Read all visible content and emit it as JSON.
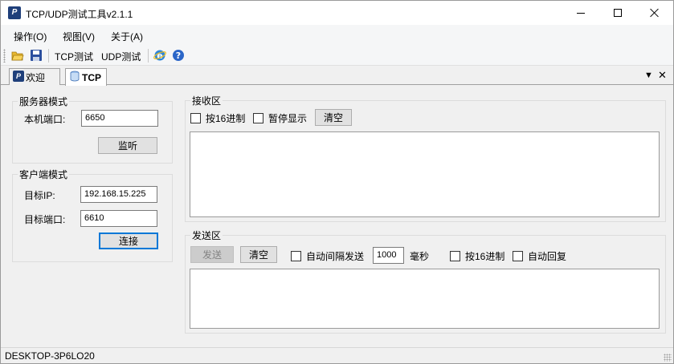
{
  "window": {
    "title": "TCP/UDP测试工具v2.1.1"
  },
  "menu": {
    "items": [
      {
        "label": "操作(O)"
      },
      {
        "label": "视图(V)"
      },
      {
        "label": "关于(A)"
      }
    ]
  },
  "toolbar": {
    "icons": [
      "open-folder-icon",
      "save-icon",
      "ie-browser-icon",
      "help-icon"
    ],
    "tcp_test_label": "TCP测试",
    "udp_test_label": "UDP测试"
  },
  "tabs": [
    {
      "label": "欢迎",
      "active": false
    },
    {
      "label": "TCP",
      "active": true
    }
  ],
  "tab_controls": {
    "dropdown": "▼",
    "close": "✕"
  },
  "server": {
    "group_title": "服务器模式",
    "port_label": "本机端口:",
    "port_value": "6650",
    "listen_button": "监听"
  },
  "client": {
    "group_title": "客户端模式",
    "ip_label": "目标IP:",
    "ip_value": "192.168.15.225",
    "port_label": "目标端口:",
    "port_value": "6610",
    "connect_button": "连接"
  },
  "receive": {
    "group_title": "接收区",
    "hex_checkbox": "按16进制",
    "hex_checked": false,
    "pause_checkbox": "暂停显示",
    "pause_checked": false,
    "clear_button": "清空"
  },
  "send": {
    "group_title": "发送区",
    "send_button": "发送",
    "clear_button": "清空",
    "auto_send_checkbox": "自动间隔发送",
    "auto_send_checked": false,
    "interval_value": "1000",
    "interval_unit": "毫秒",
    "hex_checkbox": "按16进制",
    "hex_checked": false,
    "auto_reply_checkbox": "自动回复",
    "auto_reply_checked": false
  },
  "status": {
    "computer_name": "DESKTOP-3P6LO20"
  },
  "colors": {
    "accent_focus": "#0078d7",
    "app_icon": "#1f3f7a"
  }
}
